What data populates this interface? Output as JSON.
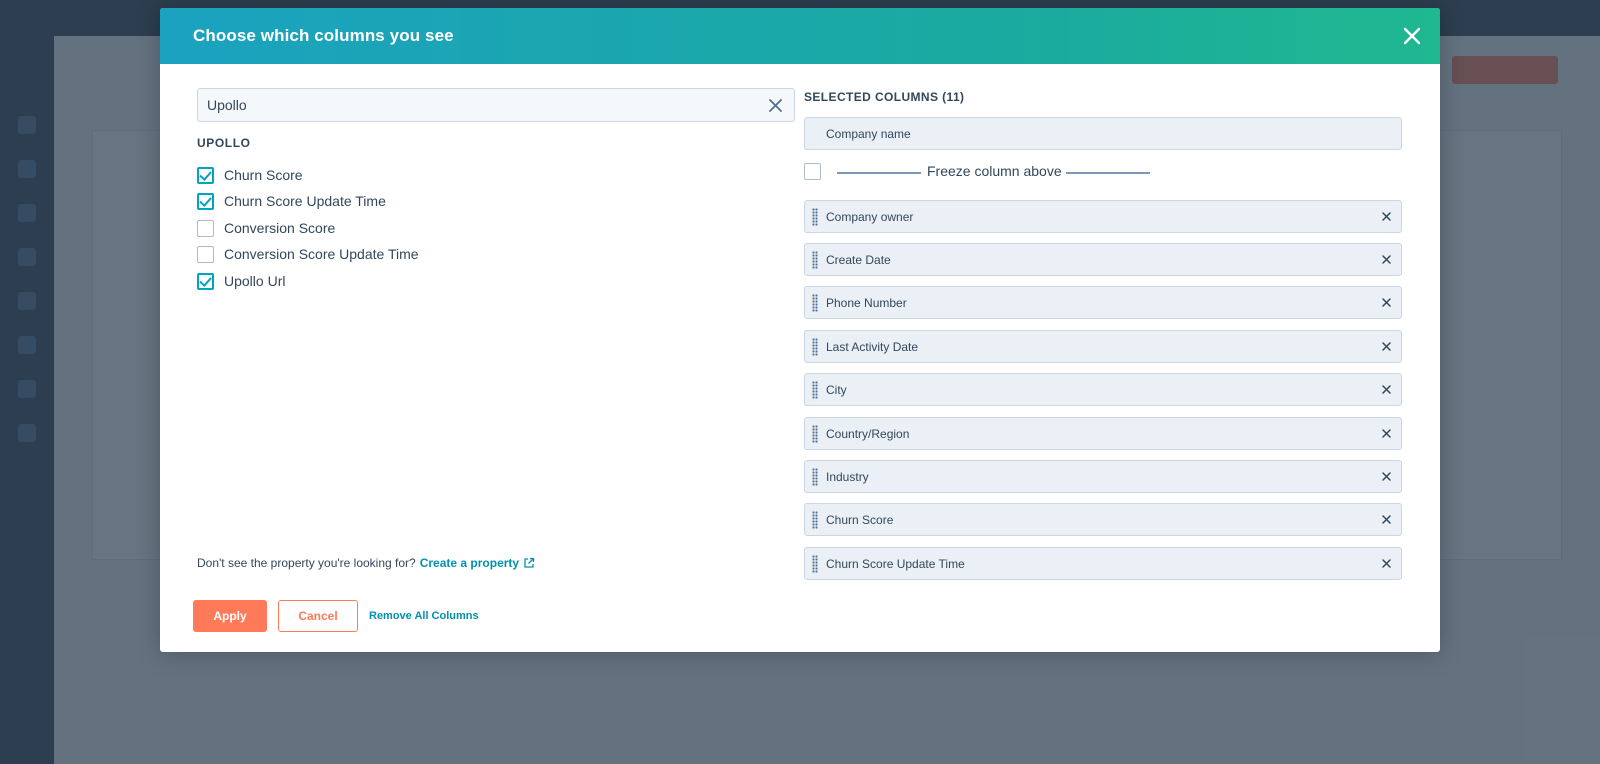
{
  "modal": {
    "title": "Choose which columns you see"
  },
  "search": {
    "value": "Upollo"
  },
  "group": {
    "label": "UPOLLO",
    "options": [
      {
        "label": "Churn Score",
        "checked": true
      },
      {
        "label": "Churn Score Update Time",
        "checked": true
      },
      {
        "label": "Conversion Score",
        "checked": false
      },
      {
        "label": "Conversion Score Update Time",
        "checked": false
      },
      {
        "label": "Upollo Url",
        "checked": true
      }
    ]
  },
  "help": {
    "text": "Don't see the property you're looking for?",
    "link": "Create a property"
  },
  "selected": {
    "title": "SELECTED COLUMNS (11)",
    "fixed": "Company name",
    "freeze_label": "Freeze column above",
    "items": [
      "Company owner",
      "Create Date",
      "Phone Number",
      "Last Activity Date",
      "City",
      "Country/Region",
      "Industry",
      "Churn Score",
      "Churn Score Update Time"
    ]
  },
  "footer": {
    "apply": "Apply",
    "cancel": "Cancel",
    "remove_all": "Remove All Columns"
  },
  "colors": {
    "header_start": "#1ba2c0",
    "header_end": "#1fb890",
    "primary": "#ff7a59",
    "link": "#0091ae",
    "check": "#00a4bd"
  }
}
